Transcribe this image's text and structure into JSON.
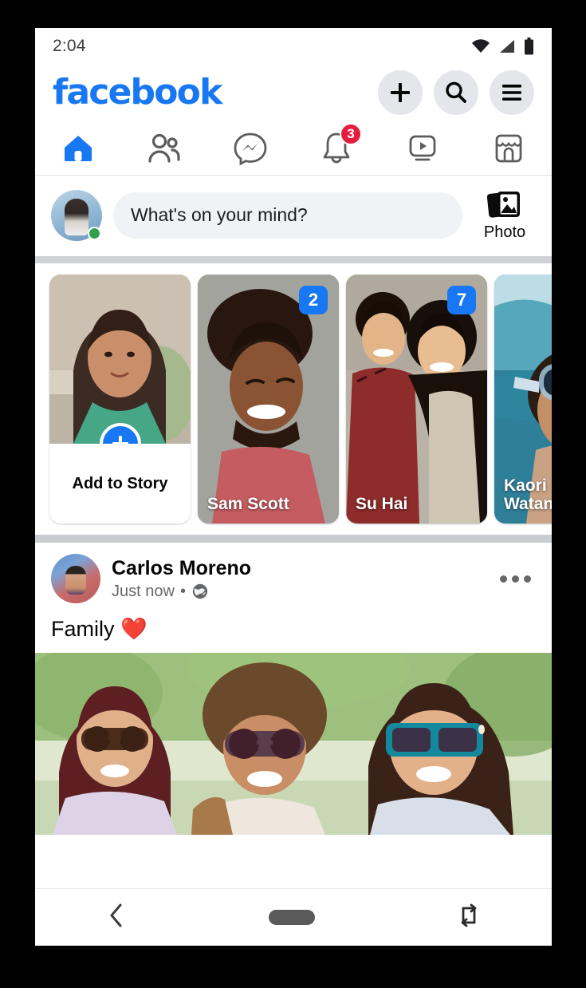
{
  "statusbar": {
    "time": "2:04",
    "icons": [
      "wifi-icon",
      "cellular-signal-icon",
      "battery-icon"
    ]
  },
  "appbar": {
    "logo": "facebook",
    "logo_color": "#1877F2",
    "actions": [
      {
        "name": "create-button",
        "icon": "plus-icon",
        "label": "+"
      },
      {
        "name": "search-button",
        "icon": "search-icon",
        "label": ""
      },
      {
        "name": "menu-button",
        "icon": "hamburger-menu-icon",
        "label": ""
      }
    ]
  },
  "tabs": [
    {
      "name": "tab-home",
      "icon": "home-icon",
      "active": true,
      "badge": ""
    },
    {
      "name": "tab-friends",
      "icon": "friends-icon",
      "active": false,
      "badge": ""
    },
    {
      "name": "tab-messenger",
      "icon": "messenger-icon",
      "active": false,
      "badge": ""
    },
    {
      "name": "tab-notifications",
      "icon": "bell-icon",
      "active": false,
      "badge": "3"
    },
    {
      "name": "tab-watch",
      "icon": "video-play-icon",
      "active": false,
      "badge": ""
    },
    {
      "name": "tab-marketplace",
      "icon": "marketplace-store-icon",
      "active": false,
      "badge": ""
    }
  ],
  "composer": {
    "placeholder": "What's on your mind?",
    "avatar_status": "online",
    "photo_button_label": "Photo",
    "photo_button_icon": "photo-stack-icon"
  },
  "stories": [
    {
      "name": "Add to Story",
      "type": "add",
      "badge": "",
      "plus_icon": "plus-icon"
    },
    {
      "name": "Sam Scott",
      "type": "story",
      "badge": "2"
    },
    {
      "name": "Su Hai",
      "type": "story",
      "badge": "7"
    },
    {
      "name": "Kaori Watanabe",
      "type": "story",
      "badge": ""
    }
  ],
  "post": {
    "author": "Carlos Moreno",
    "timestamp": "Just now",
    "separator": "•",
    "privacy_icon": "globe-public-icon",
    "more_icon": "more-options-icon",
    "text": "Family ❤️"
  },
  "android_nav": [
    {
      "name": "back-button",
      "icon": "back-chevron-icon"
    },
    {
      "name": "home-button",
      "icon": "home-pill-icon"
    },
    {
      "name": "rotate-screen-button",
      "icon": "rotate-screen-icon"
    }
  ],
  "colors": {
    "brand_blue": "#1877F2",
    "badge_red": "#E41E3F",
    "online_green": "#31A24C",
    "surface_gray": "#F0F2F5",
    "button_gray": "#E4E6EB",
    "divider_gray": "#CED0D4",
    "text_secondary": "#65676B"
  }
}
